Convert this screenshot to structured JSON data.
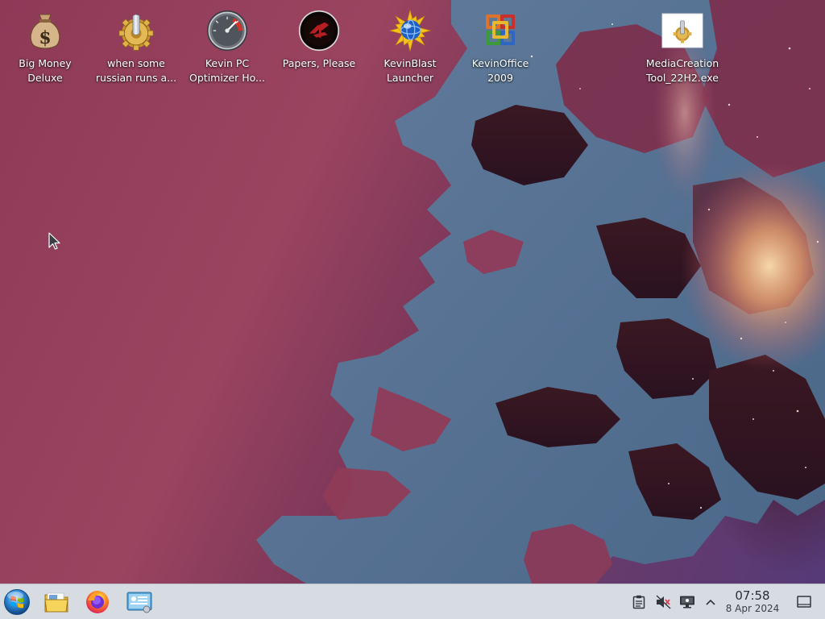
{
  "desktop": {
    "icons": [
      {
        "label": "Big Money\nDeluxe",
        "icon": "money-bag-icon"
      },
      {
        "label": "when some\nrussian runs a...",
        "icon": "gear-icon"
      },
      {
        "label": "Kevin PC\nOptimizer Ho...",
        "icon": "speedometer-icon"
      },
      {
        "label": "Papers, Please",
        "icon": "papers-please-icon"
      },
      {
        "label": "KevinBlast\nLauncher",
        "icon": "starburst-globe-icon"
      },
      {
        "label": "KevinOffice\n2009",
        "icon": "office-logo-icon"
      },
      {
        "label": "MediaCreation\nTool_22H2.exe",
        "icon": "installer-icon"
      }
    ]
  },
  "taskbar": {
    "start_icon": "windows-orb-icon",
    "pinned": [
      {
        "name": "file-manager",
        "icon": "folder-icon"
      },
      {
        "name": "firefox",
        "icon": "firefox-icon"
      },
      {
        "name": "system-settings",
        "icon": "settings-panel-icon"
      }
    ],
    "tray": [
      {
        "name": "clipboard",
        "icon": "clipboard-icon"
      },
      {
        "name": "volume",
        "icon": "speaker-muted-icon"
      },
      {
        "name": "display",
        "icon": "monitor-icon"
      },
      {
        "name": "expand",
        "icon": "chevron-up-icon"
      }
    ],
    "clock": {
      "time": "07:58",
      "date": "8 Apr 2024"
    },
    "show_desktop_icon": "show-desktop-icon"
  },
  "colors": {
    "taskbar_bg": "#d7dce3",
    "label_text": "#ffffff",
    "clock_text": "#2a2e33"
  }
}
